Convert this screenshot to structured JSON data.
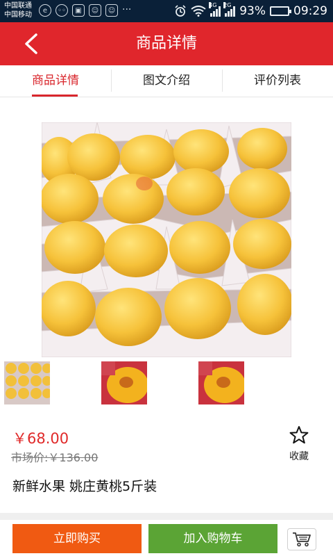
{
  "status_bar": {
    "carrier1": "中国联通",
    "carrier2": "中国移动",
    "net1": "4G",
    "net2": "2G",
    "battery": "93%",
    "time": "09:29",
    "battery_level": 0.93
  },
  "header": {
    "title": "商品详情"
  },
  "tabs": [
    {
      "label": "商品详情",
      "active": true
    },
    {
      "label": "图文介绍",
      "active": false
    },
    {
      "label": "评价列表",
      "active": false
    }
  ],
  "product": {
    "price": "￥68.00",
    "market_price": "市场价:￥136.00",
    "name": "新鲜水果 姚庄黄桃5斤装",
    "favorite_label": "收藏"
  },
  "actions": {
    "buy_now": "立即购买",
    "add_to_cart": "加入购物车"
  },
  "colors": {
    "brand_red": "#e0262c",
    "buy_orange": "#f05a12",
    "cart_green": "#5ba435",
    "price_red": "#e02a2a"
  },
  "icons": {
    "back": "chevron-left-icon",
    "favorite": "star-outline-icon",
    "cart": "shopping-cart-icon"
  }
}
